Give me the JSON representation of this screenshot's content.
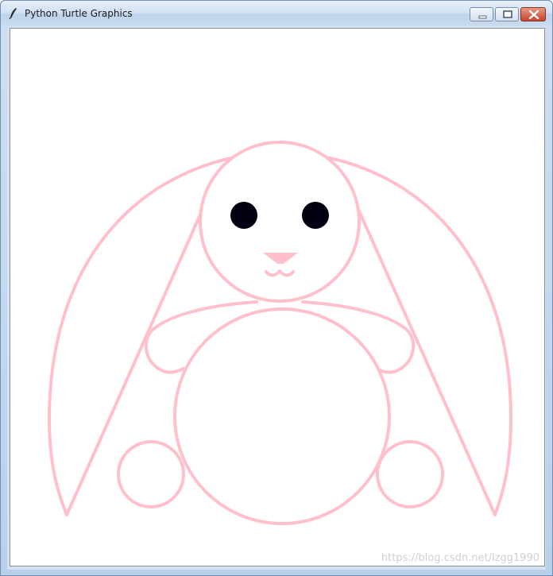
{
  "window": {
    "title": "Python Turtle Graphics",
    "icon": "feather-pen-icon"
  },
  "controls": {
    "minimize_icon": "minimize-icon",
    "maximize_icon": "maximize-icon",
    "close_icon": "close-icon"
  },
  "drawing": {
    "subject": "rabbit",
    "stroke_color": "#ffc0cb",
    "eye_color": "#000011",
    "nose_color": "#ffc0cb"
  },
  "watermark": {
    "text": "https://blog.csdn.net/lzgg1990"
  }
}
